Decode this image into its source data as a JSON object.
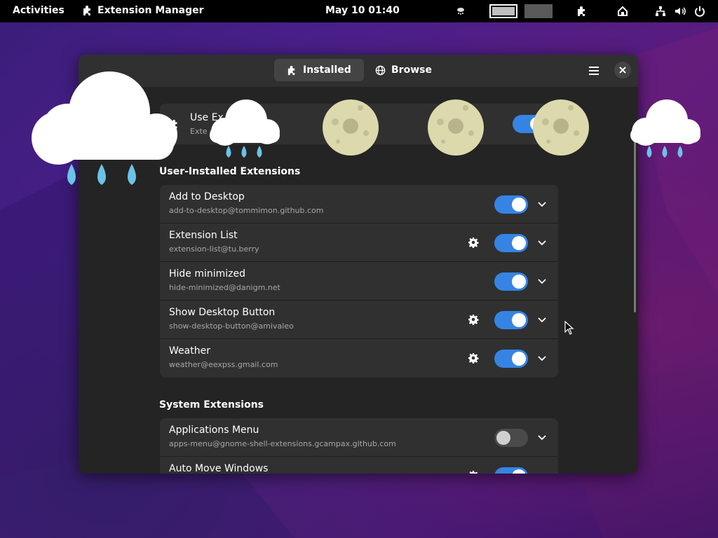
{
  "topbar": {
    "activities": "Activities",
    "app_name": "Extension Manager",
    "clock": "May 10  01:40"
  },
  "window": {
    "tabs": [
      {
        "label": "Installed",
        "icon": "puzzle-icon",
        "active": true
      },
      {
        "label": "Browse",
        "icon": "globe-icon",
        "active": false
      }
    ],
    "use_extensions": {
      "title": "Use Ex",
      "subtitle": "Exte                        erformance                  sues.",
      "enabled": true
    },
    "user_section": {
      "title": "User-Installed Extensions",
      "items": [
        {
          "name": "Add to Desktop",
          "uuid": "add-to-desktop@tommimon.github.com",
          "has_settings": false,
          "enabled": true
        },
        {
          "name": "Extension List",
          "uuid": "extension-list@tu.berry",
          "has_settings": true,
          "enabled": true
        },
        {
          "name": "Hide minimized",
          "uuid": "hide-minimized@danigm.net",
          "has_settings": false,
          "enabled": true
        },
        {
          "name": "Show Desktop Button",
          "uuid": "show-desktop-button@amivaleo",
          "has_settings": true,
          "enabled": true
        },
        {
          "name": "Weather",
          "uuid": "weather@eexpss.gmail.com",
          "has_settings": true,
          "enabled": true
        }
      ]
    },
    "system_section": {
      "title": "System Extensions",
      "items": [
        {
          "name": "Applications Menu",
          "uuid": "apps-menu@gnome-shell-extensions.gcampax.github.com",
          "has_settings": false,
          "enabled": false
        },
        {
          "name": "Auto Move Windows",
          "uuid": "",
          "has_settings": true,
          "enabled": true
        }
      ]
    }
  },
  "colors": {
    "accent": "#3584e4",
    "window_bg": "#242424",
    "card_bg": "#303030",
    "topbar_bg": "#000000"
  }
}
